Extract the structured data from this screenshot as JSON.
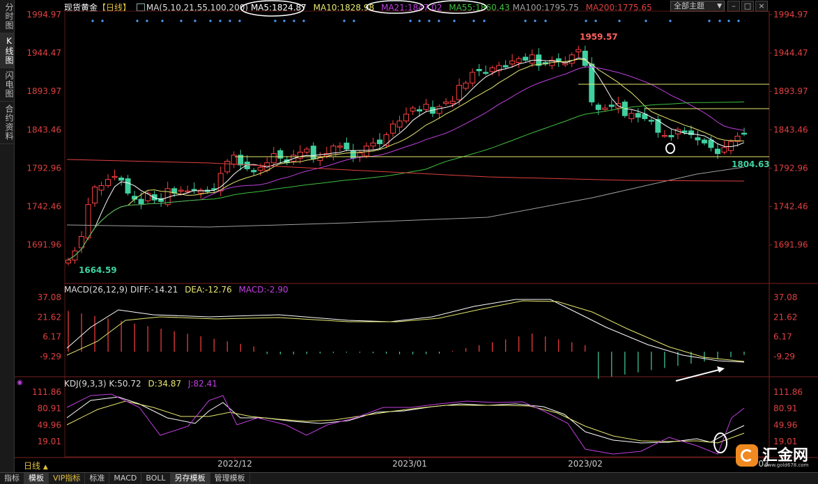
{
  "sidebar": {
    "tabs": [
      {
        "label": "分时图",
        "active": false
      },
      {
        "label": "K线图",
        "active": true
      },
      {
        "label": "闪电图",
        "active": false
      },
      {
        "label": "合约资料",
        "active": false
      }
    ]
  },
  "header": {
    "instrument": "现货黄金",
    "period": "【日线】",
    "ma_label": "MA(5,10,21,55,100,200)",
    "ma5": "MA5:1824.87",
    "ma10": "MA10:1828.98",
    "ma21": "MA21:1847.02",
    "ma55": "MA55:1860.43",
    "ma100": "MA100:1795.75",
    "ma200": "MA200:1775.65",
    "theme_button": "全部主题",
    "theme_caret": "▼"
  },
  "price_axis": {
    "ticks": [
      "1994.97",
      "1944.47",
      "1893.97",
      "1843.46",
      "1792.96",
      "1742.46",
      "1691.96"
    ],
    "high_label": "1959.57",
    "low_label": "1664.59",
    "recent_low_label": "1804.63"
  },
  "macd": {
    "label": "MACD(26,12,9)",
    "diff": "DIFF:-14.21",
    "dea": "DEA:-12.76",
    "macd": "MACD:-2.90",
    "ticks": [
      "37.08",
      "21.62",
      "6.17",
      "-9.29"
    ]
  },
  "kdj": {
    "label": "KDJ(9,3,3)",
    "k": "K:50.72",
    "d": "D:34.87",
    "j": "J:82.41",
    "ticks": [
      "111.86",
      "80.91",
      "49.96",
      "19.01"
    ]
  },
  "time_axis": {
    "labels": [
      "2022/12",
      "2023/01",
      "2023/02",
      "03"
    ],
    "period_label": "日线",
    "period_caret": "▲"
  },
  "bottom_tabs": [
    {
      "label": "指标",
      "active": false,
      "vip": false
    },
    {
      "label": "模板",
      "active": true,
      "vip": false
    },
    {
      "label": "VIP指标",
      "active": false,
      "vip": true
    },
    {
      "label": "标准",
      "active": false,
      "vip": false
    },
    {
      "label": "MACD",
      "active": false,
      "vip": false
    },
    {
      "label": "BOLL",
      "active": false,
      "vip": false
    },
    {
      "label": "另存模板",
      "active": true,
      "vip": false
    },
    {
      "label": "管理模板",
      "active": false,
      "vip": false
    }
  ],
  "logo": {
    "name": "汇金网",
    "url_text": "www.gold678.com"
  },
  "colors": {
    "up": "#ff4040",
    "down": "#40d0a0",
    "ma5": "#ffffff",
    "ma10": "#e8e870",
    "ma21": "#c040e0",
    "ma55": "#40c040",
    "ma100": "#a0a0a0",
    "ma200": "#e04040",
    "axis_text": "#e04040"
  },
  "chart_data": [
    {
      "type": "candlestick",
      "title": "现货黄金 日线",
      "ylim": [
        1650,
        2005
      ],
      "x": [
        "2022/12",
        "2023/01",
        "2023/02",
        "03"
      ],
      "high": 1959.57,
      "low": 1664.59,
      "recent_low": 1804.63,
      "series": [
        {
          "name": "MA5",
          "last": 1824.87
        },
        {
          "name": "MA10",
          "last": 1828.98
        },
        {
          "name": "MA21",
          "last": 1847.02
        },
        {
          "name": "MA55",
          "last": 1860.43
        },
        {
          "name": "MA100",
          "last": 1795.75
        },
        {
          "name": "MA200",
          "last": 1775.65
        }
      ]
    },
    {
      "type": "line",
      "title": "MACD(26,12,9)",
      "ylim": [
        -15,
        40
      ],
      "series": [
        {
          "name": "DIFF",
          "last": -14.21
        },
        {
          "name": "DEA",
          "last": -12.76
        },
        {
          "name": "MACD",
          "last": -2.9
        }
      ]
    },
    {
      "type": "line",
      "title": "KDJ(9,3,3)",
      "ylim": [
        0,
        120
      ],
      "series": [
        {
          "name": "K",
          "last": 50.72
        },
        {
          "name": "D",
          "last": 34.87
        },
        {
          "name": "J",
          "last": 82.41
        }
      ]
    }
  ]
}
